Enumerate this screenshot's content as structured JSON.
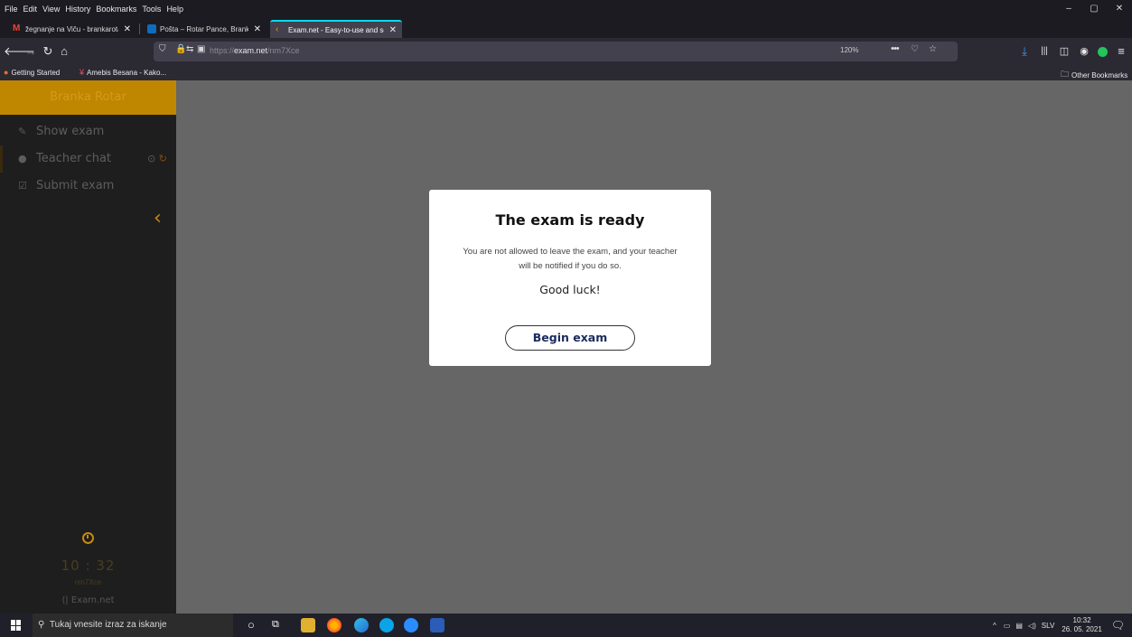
{
  "menubar": {
    "items": [
      "File",
      "Edit",
      "View",
      "History",
      "Bookmarks",
      "Tools",
      "Help"
    ]
  },
  "window_controls": {
    "minimize": "–",
    "maximize": "▢",
    "close": "✕"
  },
  "tabs": [
    {
      "title": "žegnanje na Viču - brankarotar",
      "icon": "gmail-icon"
    },
    {
      "title": "Pošta – Rotar Pance, Branka – ",
      "icon": "outlook-icon"
    },
    {
      "title": "Exam.net - Easy-to-use and se",
      "icon": "exam-net-icon",
      "active": true
    }
  ],
  "newtab_label": "+",
  "url": {
    "scheme": "https://",
    "domain": "exam.net",
    "path": "/nm7Xce"
  },
  "zoom": "120%",
  "bookmarks": {
    "items": [
      "Getting Started",
      "Amebis Besana - Kako..."
    ],
    "other": "Other Bookmarks"
  },
  "sidebar": {
    "user_name": "Branka Rotar",
    "items": [
      "Show exam",
      "Teacher chat",
      "Submit exam"
    ],
    "timer": "10 : 32",
    "exam_code": "nm7Xce",
    "brand": "Exam.net"
  },
  "modal": {
    "title": "The exam is ready",
    "message": "You are not allowed to leave the exam, and your teacher will be notified if you do so.",
    "luck": "Good luck!",
    "button": "Begin exam"
  },
  "taskbar": {
    "search_placeholder": "Tukaj vnesite izraz za iskanje",
    "language": "SLV",
    "time": "10:32",
    "date": "26. 05. 2021"
  },
  "colors": {
    "accent": "#c48a12",
    "user_bar": "#bf8600",
    "tab_highlight": "#00ddff"
  }
}
